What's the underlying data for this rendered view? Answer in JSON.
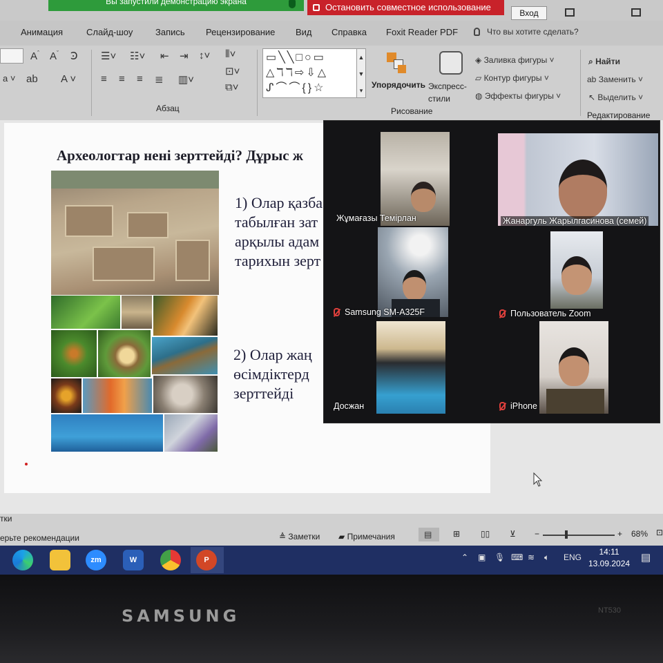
{
  "share_bar": {
    "message": "Вы запустили демонстрацию экрана",
    "stop_label": "Остановить совместное использование",
    "signin_label": "Вход"
  },
  "ribbon": {
    "tabs": [
      "Анимация",
      "Слайд-шоу",
      "Запись",
      "Рецензирование",
      "Вид",
      "Справка",
      "Foxit Reader PDF"
    ],
    "tell_me": "Что вы хотите сделать?",
    "groups": {
      "paragraph": "Абзац",
      "drawing": "Рисование",
      "editing": "Редактирование"
    },
    "arrange_label": "Упорядочить",
    "quick_styles_label": "Экспресс-стили",
    "shape_fill": "Заливка фигуры",
    "shape_outline": "Контур фигуры",
    "shape_effects": "Эффекты фигуры",
    "find": "Найти",
    "replace": "Заменить",
    "select": "Выделить"
  },
  "slide": {
    "title": "Археологтар нені зерттейді? Дұрыс ж",
    "option1": [
      "1) Олар қазба",
      "табылған зат",
      "арқылы адам",
      "тарихын зерт"
    ],
    "option2": [
      "2) Олар жаң",
      "өсімдіктерд",
      "зерттейді"
    ]
  },
  "zoom": {
    "participants": [
      {
        "name": "Жұмағазы Темірлан",
        "muted": false
      },
      {
        "name": "Жанаргуль Жарылгасинова (семей)",
        "muted": false
      },
      {
        "name": "Samsung SM-A325F",
        "muted": true
      },
      {
        "name": "Пользователь Zoom",
        "muted": true
      },
      {
        "name": "Досжан",
        "muted": false
      },
      {
        "name": "iPhone",
        "muted": true
      }
    ]
  },
  "status_bar": {
    "notes_partial": "тки",
    "recommendations_partial": "ерьте рекомендации",
    "notes": "Заметки",
    "comments": "Примечания",
    "zoom_level": "68%"
  },
  "taskbar": {
    "apps": [
      "edge-icon",
      "file-explorer-icon",
      "zoom-icon",
      "word-icon",
      "chrome-icon",
      "powerpoint-icon"
    ],
    "language": "ENG",
    "time": "14:11",
    "date": "13.09.2024"
  },
  "device": {
    "brand": "SAMSUNG",
    "model": "NT530"
  },
  "colors": {
    "share_green": "#2e9b3b",
    "stop_red": "#c8222a",
    "taskbar": "#1f2f63",
    "ribbon": "#cfcfcf"
  }
}
